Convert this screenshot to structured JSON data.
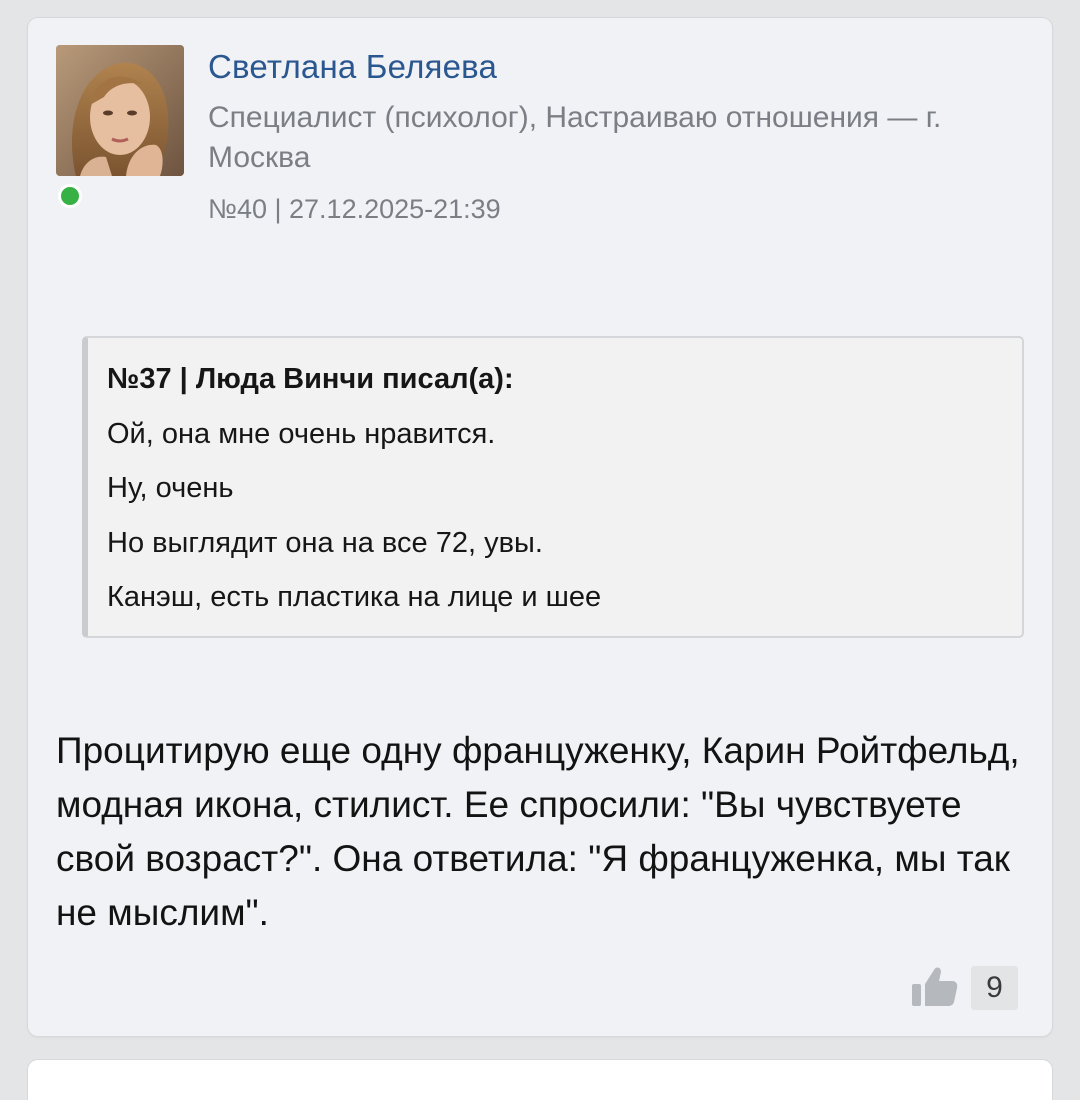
{
  "post": {
    "author_name": "Светлана Беляева",
    "author_role": "Специалист (психолог), Настраиваю отношения — г. Москва",
    "meta": "№40 | 27.12.2025-21:39",
    "online": true,
    "quote": {
      "header": "№37 | Люда Винчи писал(а):",
      "lines": [
        "Ой, она мне очень нравится.",
        "Ну, очень",
        "Но выглядит она на все 72, увы.",
        "Канэш, есть пластика на лице и шее"
      ]
    },
    "body": "Процитирую еще одну француженку, Карин Ройтфельд, модная икона, стилист. Ее спросили: \"Вы чувствуете свой возраст?\". Она ответила: \"Я француженка, мы так не мыслим\".",
    "likes": {
      "icon": "thumbs-up-icon",
      "count": "9"
    }
  },
  "colors": {
    "author_name": "#2b5790",
    "online": "#38b144",
    "card_bg": "#f0f2f5",
    "page_bg": "#e4e5e6"
  }
}
